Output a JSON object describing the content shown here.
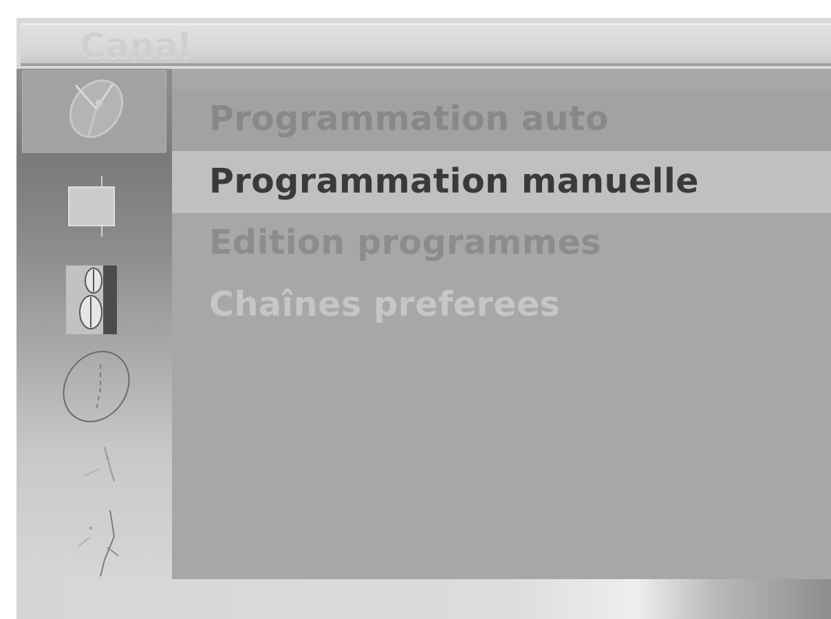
{
  "title": "Canal",
  "sidebar": {
    "items": [
      {
        "icon": "satellite-dish-icon",
        "selected": true
      },
      {
        "icon": "picture-icon",
        "selected": false
      },
      {
        "icon": "speaker-icon",
        "selected": false
      },
      {
        "icon": "clock-icon",
        "selected": false
      },
      {
        "icon": "settings-icon",
        "selected": false
      },
      {
        "icon": "input-icon",
        "selected": false
      }
    ]
  },
  "menu": {
    "items": [
      {
        "label": "Programmation auto",
        "state": "dimmed"
      },
      {
        "label": "Programmation manuelle",
        "state": "highlighted"
      },
      {
        "label": "Edition programmes",
        "state": "normal"
      },
      {
        "label": "Chaînes preferees",
        "state": "faded"
      }
    ]
  }
}
